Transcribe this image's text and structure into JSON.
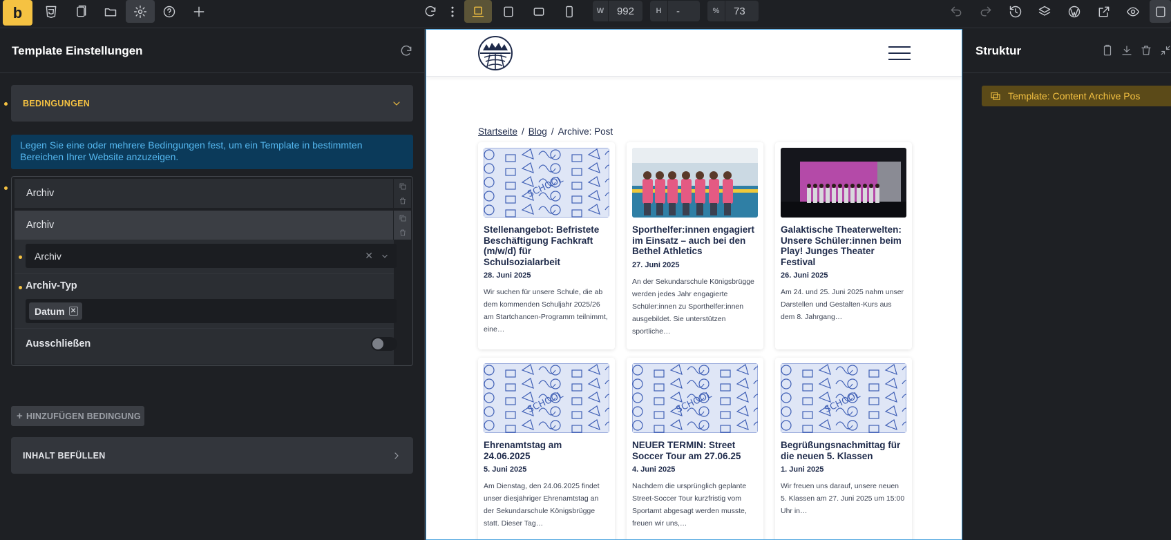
{
  "app": {
    "logo_letter": "b"
  },
  "toolbar": {
    "width_label": "W",
    "width_value": "992",
    "height_label": "H",
    "height_value": "-",
    "zoom_label": "%",
    "zoom_value": "73"
  },
  "left_panel": {
    "title": "Template Einstellungen",
    "conditions_header": "BEDINGUNGEN",
    "info_text": "Legen Sie eine oder mehrere Bedingungen fest, um ein Template in bestimmten Bereichen Ihrer Website anzuzeigen.",
    "rows": [
      {
        "label": "Archiv"
      },
      {
        "label": "Archiv"
      }
    ],
    "main_select_value": "Archiv",
    "archive_type_label": "Archiv-Typ",
    "archive_type_tag": "Datum",
    "exclude_label": "Ausschließen",
    "add_condition_label": "HINZUFÜGEN BEDINGUNG",
    "fill_content_header": "INHALT BEFÜLLEN"
  },
  "site": {
    "breadcrumb": {
      "home": "Startseite",
      "blog": "Blog",
      "current": "Archive: Post"
    },
    "posts": [
      {
        "title": "Stellenangebot: Befristete Beschäftigung Fachkraft (m/w/d) für Schulsozialarbeit",
        "date": "28. Juni 2025",
        "excerpt": "Wir suchen für unsere Schule, die ab dem kommenden Schuljahr 2025/26 am Startchancen-Programm teilnimmt, eine…",
        "thumb": "doodle"
      },
      {
        "title": "Sporthelfer:innen engagiert im Einsatz – auch bei den Bethel Athletics",
        "date": "27. Juni 2025",
        "excerpt": "An der Sekundarschule Königsbrügge werden jedes Jahr engagierte Schüler:innen zu Sporthelfer:innen ausgebildet. Sie unterstützen sportliche…",
        "thumb": "pool"
      },
      {
        "title": "Galaktische Theaterwelten: Unsere Schüler:innen beim Play! Junges Theater Festival",
        "date": "26. Juni 2025",
        "excerpt": "Am 24. und 25. Juni 2025 nahm unser Darstellen und Gestalten-Kurs aus dem 8. Jahrgang…",
        "thumb": "stage"
      },
      {
        "title": "Ehrenamtstag am 24.06.2025",
        "date": "5. Juni 2025",
        "excerpt": "Am Dienstag, den 24.06.2025 findet unser diesjähriger Ehrenamtstag an der Sekundarschule Königsbrügge statt. Dieser Tag…",
        "thumb": "doodle"
      },
      {
        "title": "NEUER TERMIN: Street Soccer Tour am 27.06.25",
        "date": "4. Juni 2025",
        "excerpt": "Nachdem die ursprünglich geplante Street-Soccer Tour kurzfristig vom Sportamt abgesagt werden musste, freuen wir uns,…",
        "thumb": "doodle"
      },
      {
        "title": "Begrüßungsnachmittag für die neuen 5. Klassen",
        "date": "1. Juni 2025",
        "excerpt": "Wir freuen uns darauf, unsere neuen 5. Klassen am 27. Juni 2025 um 15:00 Uhr in…",
        "thumb": "doodle"
      }
    ]
  },
  "right_panel": {
    "title": "Struktur",
    "template_item": "Template: Content Archive Pos"
  },
  "colors": {
    "accent": "#f5c242",
    "info_bg": "#0b3a5a",
    "info_text": "#55b8f0",
    "site_text": "#1e2a4a"
  }
}
